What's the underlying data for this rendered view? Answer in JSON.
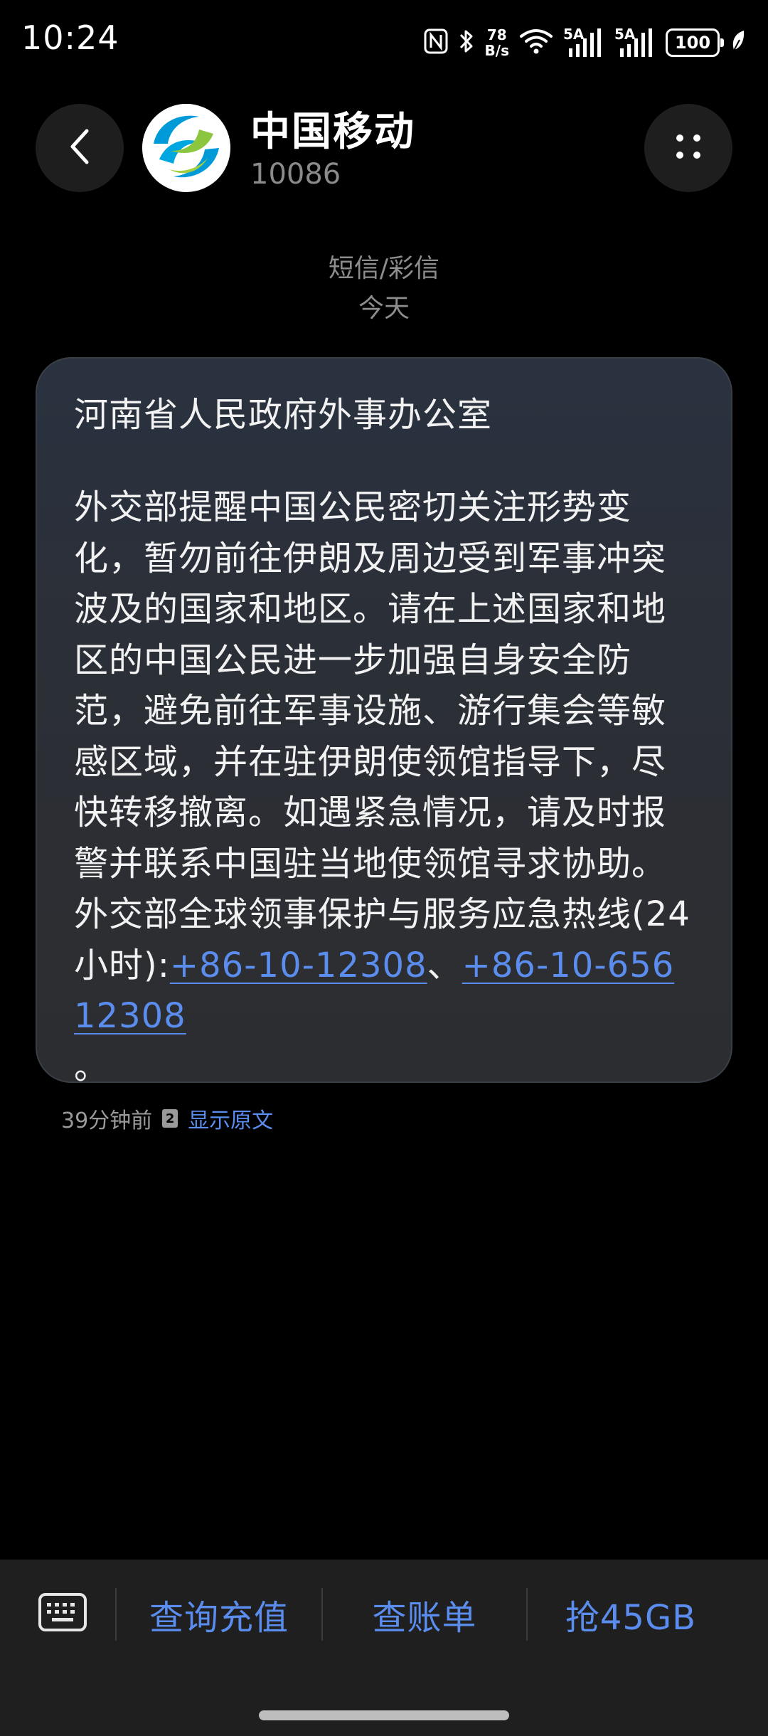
{
  "status_bar": {
    "time": "10:24",
    "net_speed_value": "78",
    "net_speed_unit": "B/s",
    "sim1_label": "5A",
    "sim2_label": "5A",
    "battery_level": "100"
  },
  "header": {
    "contact_name": "中国移动",
    "contact_number": "10086",
    "back_icon": "chevron-left-icon",
    "more_icon": "four-dots-icon"
  },
  "conversation": {
    "message_type": "短信/彩信",
    "date": "今天"
  },
  "message": {
    "title": "河南省人民政府外事办公室",
    "body_text": "外交部提醒中国公民密切关注形势变化，暂勿前往伊朗及周边受到军事冲突波及的国家和地区。请在上述国家和地区的中国公民进一步加强自身安全防范，避免前往军事设施、游行集会等敏感区域，并在驻伊朗使领馆指导下，尽快转移撤离。如遇紧急情况，请及时报警并联系中国驻当地使领馆寻求协助。外交部全球领事保护与服务应急热线(24小时):",
    "phone_1": "+86-10-12308",
    "separator": "、",
    "phone_2": "+86-10-65612308",
    "ending": "。",
    "time_ago": "39分钟前",
    "sim_badge": "2",
    "show_original": "显示原文",
    "link_color": "#5b8def"
  },
  "bottom_menu": {
    "keyboard_icon": "keyboard-icon",
    "items": [
      {
        "label": "查询充值"
      },
      {
        "label": "查账单"
      },
      {
        "label": "抢45GB"
      }
    ]
  }
}
